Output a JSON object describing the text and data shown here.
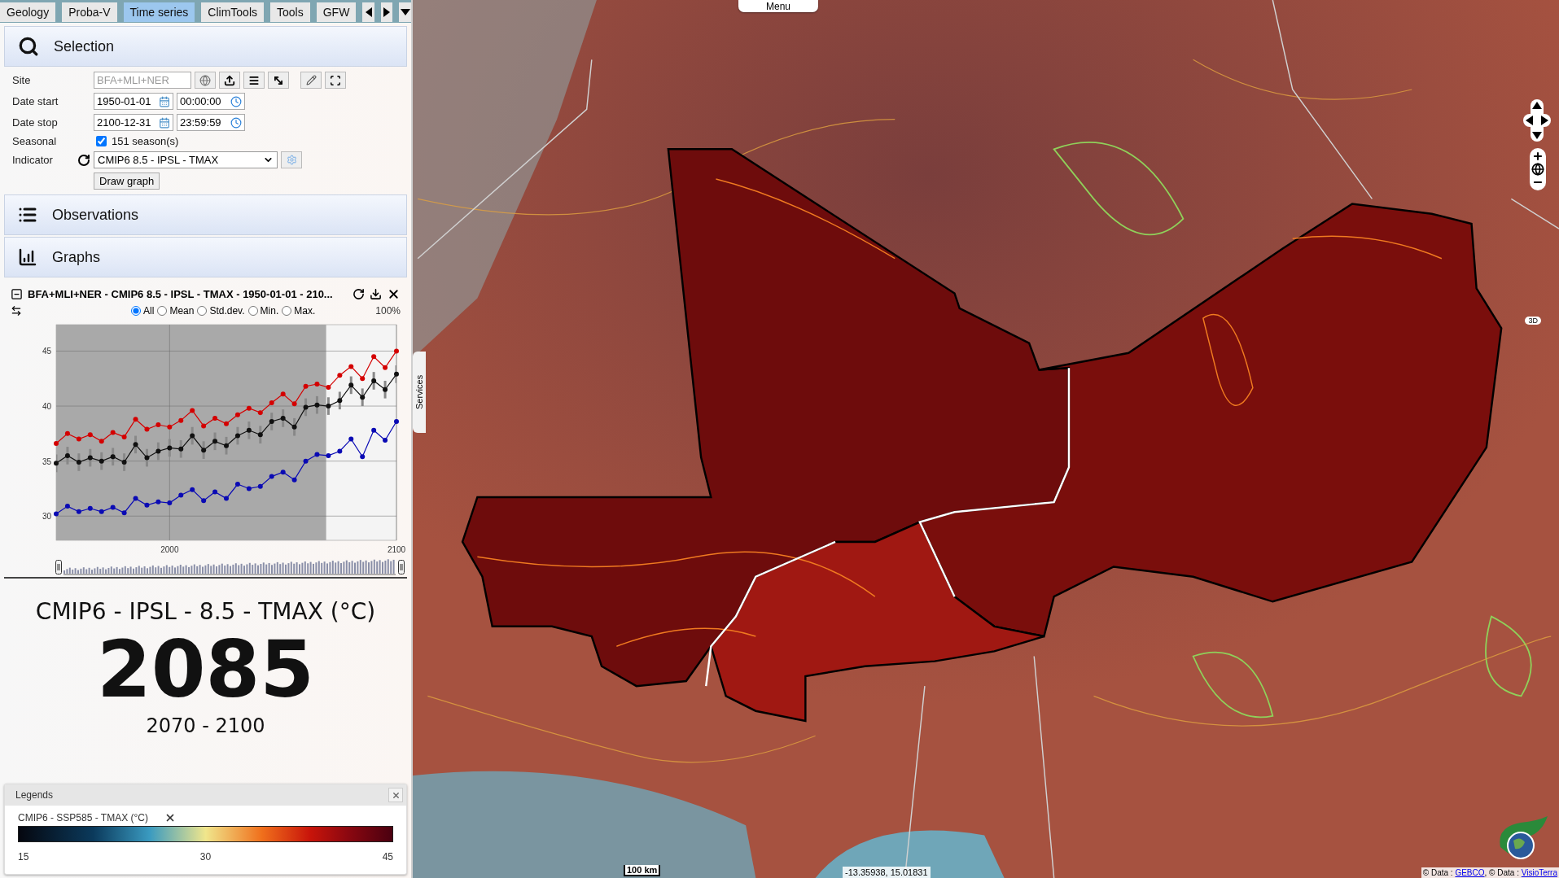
{
  "tabs": [
    {
      "label": "Geology",
      "selected": false
    },
    {
      "label": "Proba-V",
      "selected": false
    },
    {
      "label": "Time series",
      "selected": true
    },
    {
      "label": "ClimTools",
      "selected": false
    },
    {
      "label": "Tools",
      "selected": false
    },
    {
      "label": "GFW",
      "selected": false
    }
  ],
  "selection": {
    "title": "Selection",
    "site": {
      "label": "Site",
      "placeholder": "BFA+MLI+NER"
    },
    "date_start": {
      "label": "Date start",
      "date": "1950-01-01",
      "time": "00:00:00"
    },
    "date_stop": {
      "label": "Date stop",
      "date": "2100-12-31",
      "time": "23:59:59"
    },
    "seasonal": {
      "label": "Seasonal",
      "checked": true,
      "text": "151 season(s)"
    },
    "indicator": {
      "label": "Indicator",
      "value": "CMIP6 8.5 - IPSL - TMAX"
    },
    "draw_button": "Draw graph"
  },
  "sections": [
    {
      "kind": "list",
      "title": "Observations"
    },
    {
      "kind": "chart",
      "title": "Graphs"
    }
  ],
  "graph": {
    "title": "BFA+MLI+NER - CMIP6 8.5 - IPSL - TMAX - 1950-01-01 - 210...",
    "options": [
      {
        "label": "All",
        "selected": true
      },
      {
        "label": "Mean",
        "selected": false
      },
      {
        "label": "Std.dev.",
        "selected": false
      },
      {
        "label": "Min.",
        "selected": false
      },
      {
        "label": "Max.",
        "selected": false
      }
    ],
    "zoom": "100%",
    "chart_data": {
      "type": "line",
      "x": [
        1950,
        1955,
        1960,
        1965,
        1970,
        1975,
        1980,
        1985,
        1990,
        1995,
        2000,
        2005,
        2010,
        2015,
        2020,
        2025,
        2030,
        2035,
        2040,
        2045,
        2050,
        2055,
        2060,
        2065,
        2070,
        2075,
        2080,
        2085,
        2090,
        2095,
        2100
      ],
      "series": [
        {
          "color": "#d40000",
          "marker": "circle",
          "values": [
            36.6,
            37.5,
            37.0,
            37.4,
            36.8,
            37.6,
            37.2,
            38.8,
            37.9,
            38.3,
            38.1,
            38.7,
            39.6,
            38.2,
            38.9,
            38.4,
            39.2,
            39.8,
            39.4,
            40.3,
            41.1,
            40.2,
            41.8,
            42.0,
            41.7,
            42.8,
            43.6,
            42.5,
            44.5,
            43.5,
            45.0
          ]
        },
        {
          "color": "#111111",
          "marker": "circle",
          "errors": [
            0.8,
            0.8,
            0.8,
            0.8,
            0.8,
            0.8,
            0.8,
            0.8,
            0.8,
            0.8,
            0.8,
            0.8,
            0.8,
            0.8,
            0.8,
            0.8,
            0.8,
            0.8,
            0.8,
            0.8,
            0.8,
            0.8,
            0.8,
            0.8,
            0.8,
            0.8,
            0.8,
            0.8,
            0.8,
            0.8,
            0.8
          ],
          "values": [
            34.8,
            35.5,
            34.9,
            35.3,
            35.0,
            35.4,
            34.9,
            36.5,
            35.3,
            35.9,
            36.2,
            36.1,
            37.3,
            36.0,
            36.8,
            36.4,
            37.3,
            37.8,
            37.4,
            38.6,
            38.9,
            38.1,
            39.9,
            40.1,
            40.0,
            40.5,
            41.9,
            40.8,
            42.3,
            41.5,
            42.9
          ]
        },
        {
          "color": "#0a0ab4",
          "marker": "circle",
          "values": [
            30.2,
            30.9,
            30.4,
            30.7,
            30.4,
            30.8,
            30.3,
            31.6,
            31.0,
            31.3,
            31.2,
            31.9,
            32.4,
            31.4,
            32.2,
            31.6,
            32.9,
            32.5,
            32.7,
            33.6,
            34.0,
            33.3,
            35.0,
            35.6,
            35.5,
            35.9,
            37.0,
            35.4,
            37.8,
            36.9,
            38.6
          ]
        }
      ],
      "xlim": [
        1950,
        2100
      ],
      "ylim": [
        27.8,
        47.4
      ],
      "xticks": [
        2000,
        2100
      ],
      "yticks": [
        30,
        35,
        40,
        45
      ],
      "grid": true,
      "bands": [
        {
          "axis": "x",
          "from": 1950,
          "to": 2069,
          "color": "#a9a9a9"
        }
      ]
    }
  },
  "summary": {
    "title": "CMIP6 - IPSL - 8.5 - TMAX (°C)",
    "year": "2085",
    "range": "2070 - 2100"
  },
  "legends": {
    "title": "Legends",
    "items": [
      {
        "name": "CMIP6 - SSP585 - TMAX (°C)",
        "ticks": [
          "15",
          "30",
          "45"
        ]
      }
    ]
  },
  "map": {
    "menu": "Menu",
    "services": "Services",
    "badge": "3D",
    "scale": "100 km",
    "coordinates": "-13.35938, 15.01831",
    "attribution": [
      {
        "prefix": "© Data : ",
        "link": "GEBCO"
      },
      {
        "prefix": ", © Data : ",
        "link": "VisioTerra"
      }
    ]
  }
}
